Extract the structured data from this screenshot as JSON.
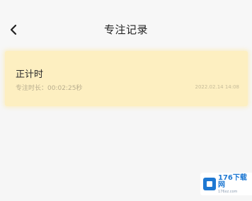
{
  "header": {
    "title": "专注记录",
    "back_icon": "chevron-left-icon"
  },
  "records": [
    {
      "name": "正计时",
      "duration": "专注时长：00:02:25秒",
      "date": "2022.02.14 14:08"
    }
  ],
  "watermark": {
    "brand": "176下载网",
    "url": "176xz.com"
  },
  "colors": {
    "card_background": "#fdefc1",
    "page_background": "#f6f6f6",
    "watermark_accent": "#1e78d2"
  }
}
